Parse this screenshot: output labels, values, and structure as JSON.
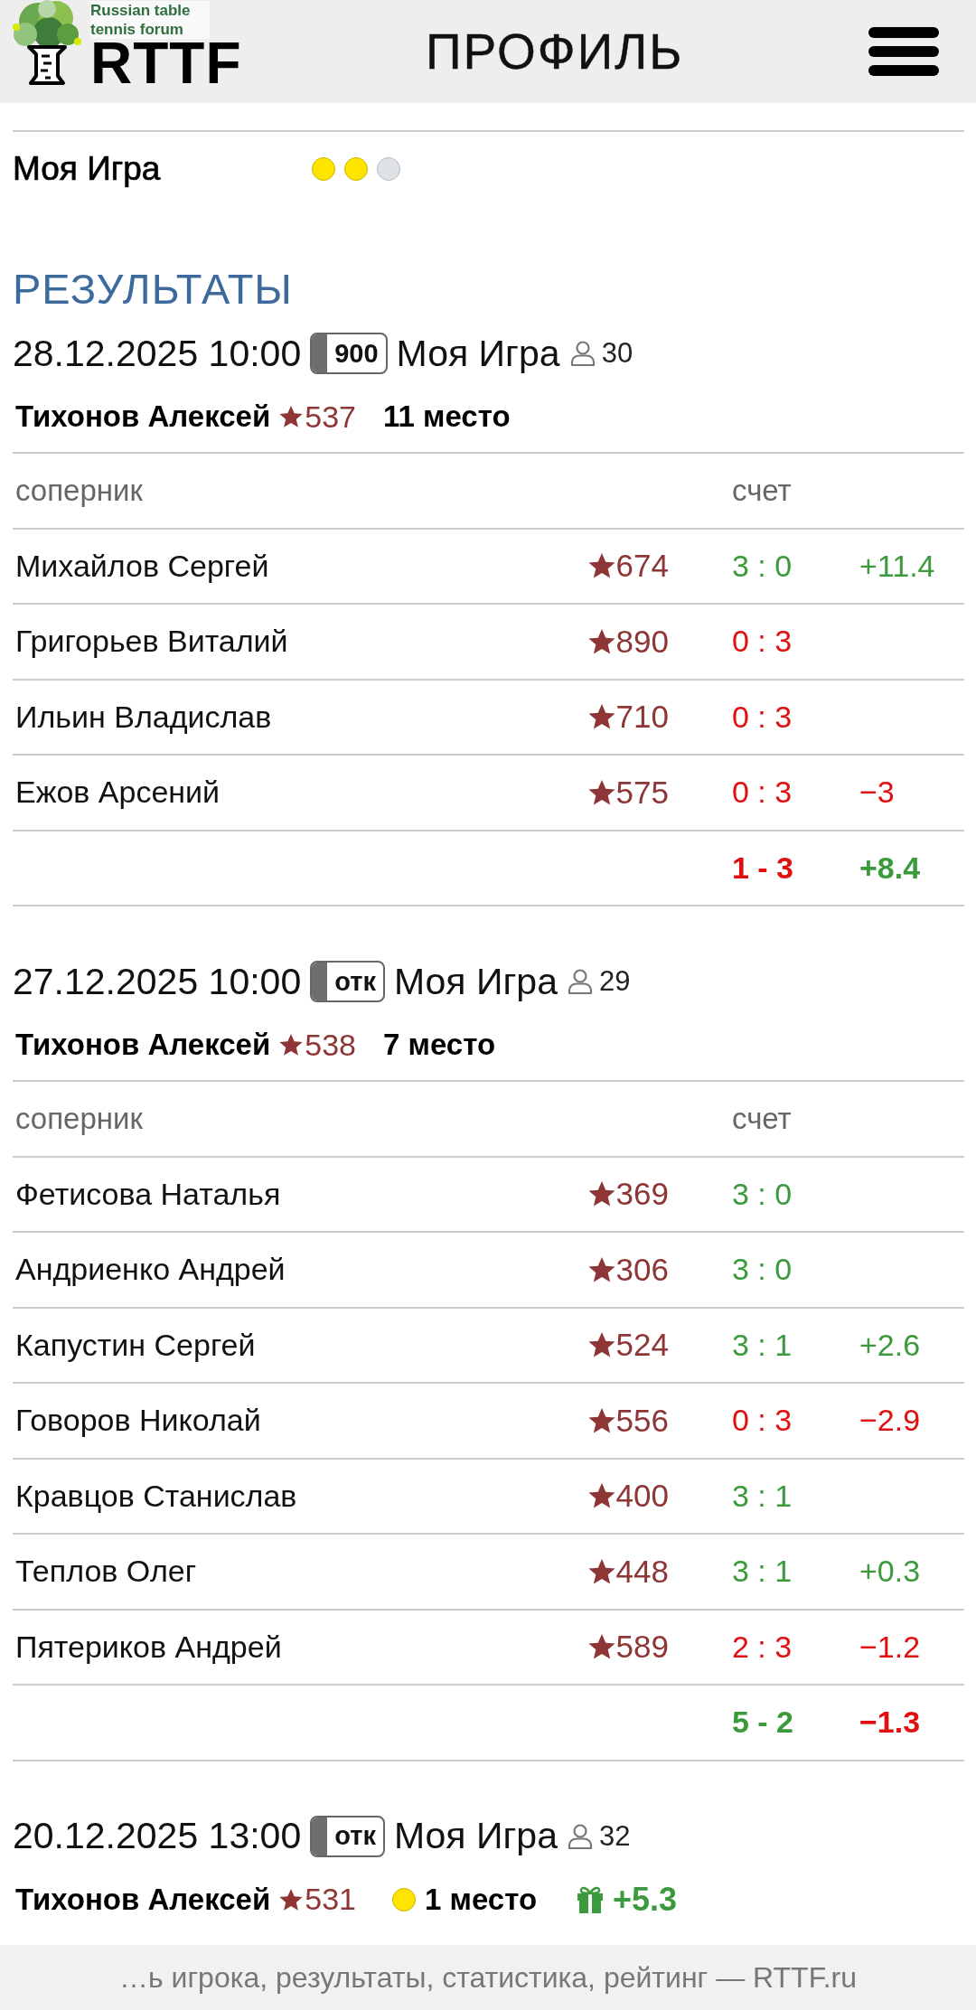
{
  "header": {
    "logo": {
      "tagline": "Russian table tennis forum",
      "name": "RTTF"
    },
    "title": "ПРОФИЛЬ"
  },
  "game": {
    "name": "Моя Игра",
    "dots": [
      {
        "filled": true
      },
      {
        "filled": true
      },
      {
        "filled": false
      }
    ]
  },
  "results": {
    "title": "РЕЗУЛЬТАТЫ",
    "events": [
      {
        "date": "28.12.2025 10:00",
        "badge": "900",
        "tournament": "Моя Игра",
        "players": "30",
        "player": {
          "name": "Тихонов Алексей",
          "rating": "537",
          "place": "11 место"
        },
        "columns": {
          "opponent": "соперник",
          "score": "счет"
        },
        "rows": [
          {
            "name": "Михайлов Сергей",
            "rating": "674",
            "score": "3 : 0",
            "won": true,
            "delta": "+11.4",
            "gain": true
          },
          {
            "name": "Григорьев Виталий",
            "rating": "890",
            "score": "0 : 3",
            "won": false
          },
          {
            "name": "Ильин Владислав",
            "rating": "710",
            "score": "0 : 3",
            "won": false
          },
          {
            "name": "Ежов Арсений",
            "rating": "575",
            "score": "0 : 3",
            "won": false,
            "delta": "−3",
            "gain": false
          }
        ],
        "total": {
          "score": "1 - 3",
          "won": false,
          "delta": "+8.4",
          "gain": true
        }
      },
      {
        "date": "27.12.2025 10:00",
        "badge": "отк",
        "tournament": "Моя Игра",
        "players": "29",
        "player": {
          "name": "Тихонов Алексей",
          "rating": "538",
          "place": "7 место"
        },
        "columns": {
          "opponent": "соперник",
          "score": "счет"
        },
        "rows": [
          {
            "name": "Фетисова Наталья",
            "rating": "369",
            "score": "3 : 0",
            "won": true
          },
          {
            "name": "Андриенко Андрей",
            "rating": "306",
            "score": "3 : 0",
            "won": true
          },
          {
            "name": "Капустин Сергей",
            "rating": "524",
            "score": "3 : 1",
            "won": true,
            "delta": "+2.6",
            "gain": true
          },
          {
            "name": "Говоров Николай",
            "rating": "556",
            "score": "0 : 3",
            "won": false,
            "delta": "−2.9",
            "gain": false
          },
          {
            "name": "Кравцов Станислав",
            "rating": "400",
            "score": "3 : 1",
            "won": true
          },
          {
            "name": "Теплов Олег",
            "rating": "448",
            "score": "3 : 1",
            "won": true,
            "delta": "+0.3",
            "gain": true
          },
          {
            "name": "Пятериков Андрей",
            "rating": "589",
            "score": "2 : 3",
            "won": false,
            "delta": "−1.2",
            "gain": false
          }
        ],
        "total": {
          "score": "5 - 2",
          "won": true,
          "delta": "−1.3",
          "gain": false
        }
      },
      {
        "date": "20.12.2025 13:00",
        "badge": "отк",
        "tournament": "Моя Игра",
        "players": "32",
        "player": {
          "name": "Тихонов Алексей",
          "rating": "531",
          "medal": true,
          "place": "1 место",
          "bonus": "+5.3"
        }
      }
    ]
  },
  "footer": {
    "text": "…ь игрока, результаты, статистика, рейтинг — RTTF.ru"
  }
}
